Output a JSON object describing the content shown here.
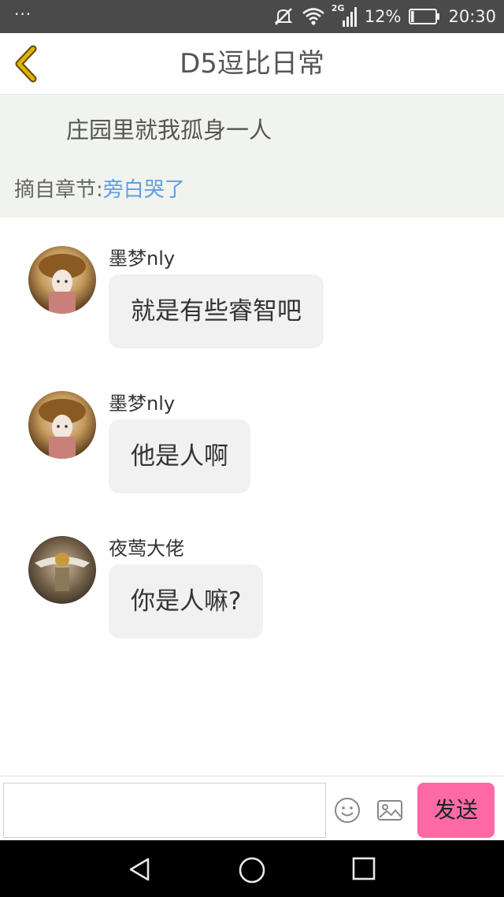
{
  "status_bar": {
    "dots": "···",
    "network": "2G",
    "battery_percent": "12%",
    "battery_level": 0.12,
    "time": "20:30",
    "icons": [
      "mute-icon",
      "wifi-icon",
      "signal-icon",
      "battery-icon"
    ]
  },
  "header": {
    "title": "D5逗比日常",
    "back_icon": "chevron-left-icon",
    "accent": "#e0b200"
  },
  "quote": {
    "text": "庄园里就我孤身一人",
    "source_label": "摘自章节:",
    "source_link": "旁白哭了",
    "link_color": "#5aa0e6"
  },
  "messages": [
    {
      "name": "墨梦nly",
      "text": "就是有些睿智吧"
    },
    {
      "name": "墨梦nly",
      "text": "他是人啊"
    },
    {
      "name": "夜莺大佬",
      "text": "你是人嘛?"
    }
  ],
  "input_bar": {
    "placeholder": "",
    "emoji_icon": "emoji-icon",
    "image_icon": "image-icon",
    "send_label": "发送",
    "send_color": "#ff6aa6"
  },
  "nav_bar": {
    "icons": [
      "back-triangle-icon",
      "home-circle-icon",
      "recents-square-icon"
    ]
  }
}
